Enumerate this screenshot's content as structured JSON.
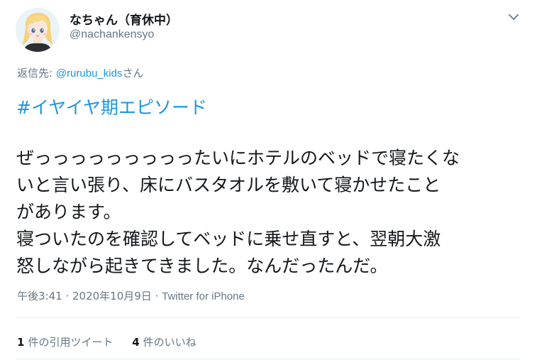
{
  "user": {
    "display_name": "なちゃん（育休中）",
    "handle": "@nachankensyo",
    "avatar_icon": "avatar-girl-blonde-icon"
  },
  "reply": {
    "prefix": "返信先: ",
    "mention": "@rurubu_kids",
    "suffix": "さん"
  },
  "tweet": {
    "hashtag": "#イヤイヤ期エピソード",
    "lines": [
      "ぜっっっっっっっっったいにホテルのベッドで寝たくな",
      "いと言い張り、床にバスタオルを敷いて寝かせたこと",
      "があります。",
      "寝ついたのを確認してベッドに乗せ直すと、翌朝大激",
      "怒しながら起きてきました。なんだったんだ。"
    ]
  },
  "meta": {
    "time": "午後3:41",
    "separator1": " · ",
    "date": "2020年10月9日",
    "separator2": " · ",
    "source": "Twitter for iPhone"
  },
  "stats": {
    "quote_count": "1",
    "quote_label": "件の引用ツイート",
    "like_count": "4",
    "like_label": "件のいいね"
  },
  "colors": {
    "link": "#1b95e0",
    "muted": "#657786",
    "text": "#14171a",
    "divider": "#e6ecf0"
  }
}
